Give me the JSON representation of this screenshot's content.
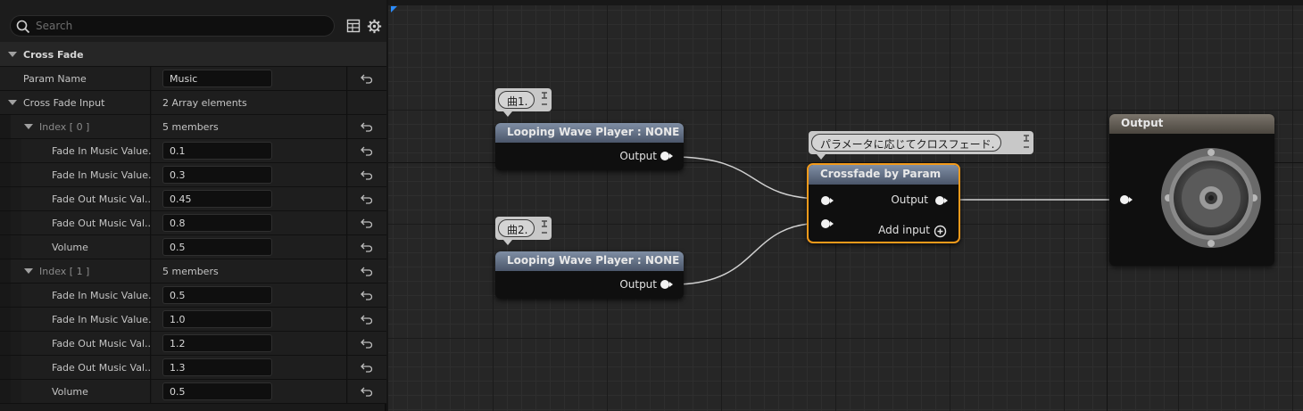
{
  "search": {
    "placeholder": "Search"
  },
  "details": {
    "section_title": "Cross Fade",
    "param_name": {
      "label": "Param Name",
      "value": "Music"
    },
    "input": {
      "label": "Cross Fade Input",
      "summary": "2 Array elements"
    },
    "indices": [
      {
        "label": "Index [ 0 ]",
        "summary": "5 members",
        "fields": [
          {
            "label": "Fade In Music Value...",
            "value": "0.1"
          },
          {
            "label": "Fade In Music Value...",
            "value": "0.3"
          },
          {
            "label": "Fade Out Music Val...",
            "value": "0.45"
          },
          {
            "label": "Fade Out Music Val...",
            "value": "0.8"
          },
          {
            "label": "Volume",
            "value": "0.5"
          }
        ]
      },
      {
        "label": "Index [ 1 ]",
        "summary": "5 members",
        "fields": [
          {
            "label": "Fade In Music Value...",
            "value": "0.5"
          },
          {
            "label": "Fade In Music Value...",
            "value": "1.0"
          },
          {
            "label": "Fade Out Music Val...",
            "value": "1.2"
          },
          {
            "label": "Fade Out Music Val...",
            "value": "1.3"
          },
          {
            "label": "Volume",
            "value": "0.5"
          }
        ]
      }
    ]
  },
  "graph": {
    "comments": {
      "track1": "曲1.",
      "track2": "曲2.",
      "crossfade": "パラメータに応じてクロスフェード."
    },
    "player1": {
      "title": "Looping Wave Player : NONE",
      "output": "Output"
    },
    "player2": {
      "title": "Looping Wave Player : NONE",
      "output": "Output"
    },
    "crossfade": {
      "title": "Crossfade by Param",
      "output": "Output",
      "add_input": "Add input"
    },
    "output_node": {
      "title": "Output"
    }
  },
  "colors": {
    "selection": "#f29a1b",
    "node_header": "#6e7c92",
    "accent": "#2b8cff"
  }
}
